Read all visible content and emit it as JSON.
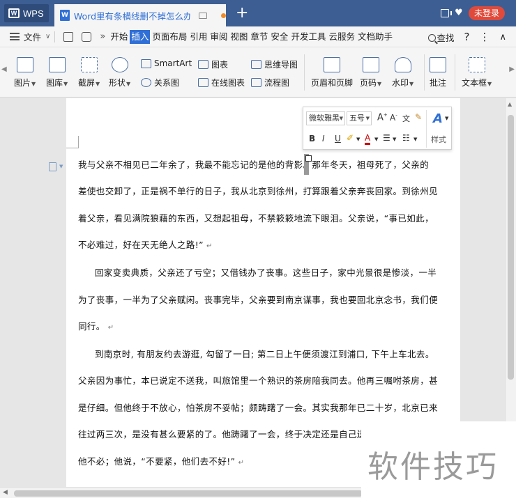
{
  "titlebar": {
    "app_tab": "WPS",
    "doc_tab_title": "Word里有条横线删不掉怎么办",
    "login_label": "未登录"
  },
  "menubar": {
    "file_label": "文件",
    "items": [
      "开始",
      "插入",
      "页面布局",
      "引用",
      "审阅",
      "视图",
      "章节",
      "安全",
      "开发工具",
      "云服务",
      "文档助手"
    ],
    "active_index": 1,
    "search_label": "查找",
    "help_label": "?",
    "more_label": "⋮",
    "collapse_label": "∧"
  },
  "ribbon": {
    "picture": "图片",
    "gallery": "图库",
    "screenshot": "截屏",
    "shape": "形状",
    "smartart": "SmartArt",
    "relation": "关系图",
    "chart": "图表",
    "online_chart": "在线图表",
    "mindmap": "思维导图",
    "flowchart": "流程图",
    "header_footer": "页眉和页脚",
    "page_number": "页码",
    "watermark": "水印",
    "comment": "批注",
    "textbox": "文本框"
  },
  "mini_toolbar": {
    "font": "微软雅黑",
    "size": "五号",
    "bold": "B",
    "italic": "I",
    "underline": "U",
    "style_label": "样式"
  },
  "document": {
    "lines": [
      "我与父亲不相见已二年余了，我最不能忘记的是他的背影。那年冬天，祖母死了，父亲的",
      "差使也交卸了，正是祸不单行的日子，我从北京到徐州，打算跟着父亲奔丧回家。到徐州见",
      "着父亲，看见满院狼藉的东西，又想起祖母，不禁簌簌地流下眼泪。父亲说，“事已如此，",
      "不必难过，好在天无绝人之路!”",
      "回家变卖典质，父亲还了亏空；又借钱办了丧事。这些日子，家中光景很是惨淡，一半",
      "为了丧事，一半为了父亲赋闲。丧事完毕，父亲要到南京谋事，我也要回北京念书，我们便",
      "同行。",
      "到南京时, 有朋友约去游逛, 勾留了一日; 第二日上午便须渡江到浦口, 下午上车北去。",
      "父亲因为事忙，本已说定不送我，叫旅馆里一个熟识的茶房陪我同去。他再三嘱咐茶房，甚",
      "是仔细。但他终于不放心，怕茶房不妥帖；颇踌躇了一会。其实我那年已二十岁，北京已来",
      "往过两三次，是没有甚么要紧的了。他踌躇了一会，终于决定还是自己送我",
      "他不必；他说，“不要紧，他们去不好!”"
    ]
  },
  "watermark_text": "软件技巧"
}
